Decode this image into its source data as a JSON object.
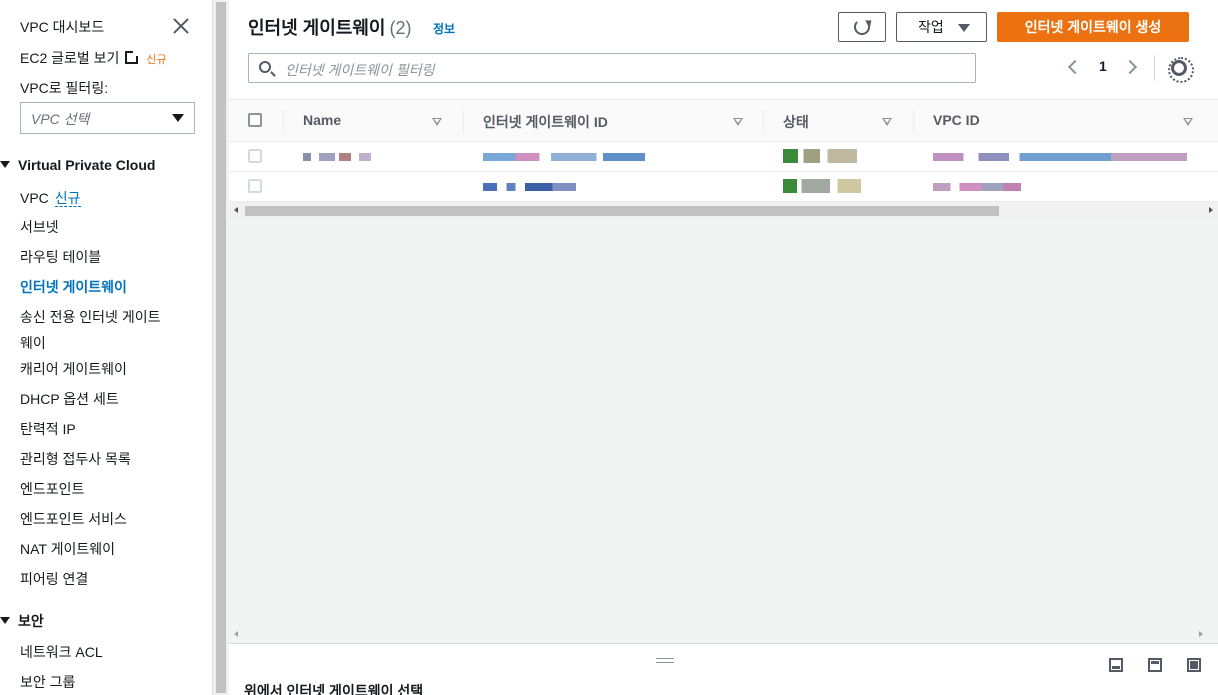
{
  "sidebar": {
    "dashboard": "VPC 대시보드",
    "ec2_global": "EC2 글로벌 보기",
    "new_badge": "신규",
    "filter_label": "VPC로 필터링:",
    "filter_select_placeholder": "VPC 선택",
    "section_vpc": "Virtual Private Cloud",
    "items": [
      {
        "label": "VPC",
        "badge": "신규"
      },
      {
        "label": "서브넷"
      },
      {
        "label": "라우팅 테이블"
      },
      {
        "label": "인터넷 게이트웨이"
      },
      {
        "label": "송신 전용 인터넷 게이트",
        "label2": "웨이"
      },
      {
        "label": "캐리어 게이트웨이"
      },
      {
        "label": "DHCP 옵션 세트"
      },
      {
        "label": "탄력적 IP"
      },
      {
        "label": "관리형 접두사 목록"
      },
      {
        "label": "엔드포인트"
      },
      {
        "label": "엔드포인트 서비스"
      },
      {
        "label": "NAT 게이트웨이"
      },
      {
        "label": "피어링 연결"
      }
    ],
    "section_security": "보안",
    "security_items": [
      {
        "label": "네트워크 ACL"
      },
      {
        "label": "보안 그룹"
      }
    ]
  },
  "header": {
    "title": "인터넷 게이트웨이",
    "count": "(2)",
    "info": "정보",
    "actions_label": "작업",
    "create_label": "인터넷 게이트웨이 생성",
    "filter_placeholder": "인터넷 게이트웨이 필터링",
    "page_number": "1"
  },
  "table": {
    "columns": [
      "Name",
      "인터넷 게이트웨이 ID",
      "상태",
      "VPC ID"
    ]
  },
  "split_panel": {
    "title": "위에서 인터넷 게이트웨이 선택"
  },
  "colors": {
    "accent": "#0073bb",
    "primary_button": "#ec7211"
  }
}
